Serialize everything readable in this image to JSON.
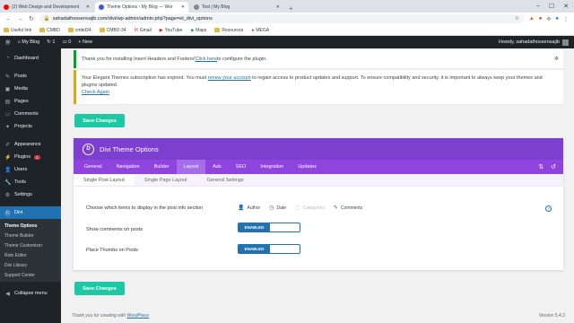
{
  "browser": {
    "tabs": [
      {
        "label": "(2) Web Design and Development",
        "active": false,
        "color": "#ff0000"
      },
      {
        "label": "Theme Options ‹ My Blog — Wor",
        "active": true,
        "color": "#3858e9"
      },
      {
        "label": "Test | My Blog",
        "active": false,
        "color": "#888888"
      }
    ],
    "new_tab": "+",
    "url": "sahadathossensajib.com/divi/wp-admin/admin.php?page=et_divi_options",
    "bookmarks": [
      "Useful link",
      "CMBD",
      "cmbd34",
      "CMBD-34",
      "Gmail",
      "YouTube",
      "Maps",
      "Resources",
      "MEGA"
    ]
  },
  "adminbar": {
    "site": "My Blog",
    "updates_count": "1",
    "comments_count": "0",
    "new_label": "New",
    "greeting": "Howdy, sahadathossensajib"
  },
  "sidebar": {
    "items": [
      {
        "label": "Dashboard",
        "icon": "dashboard-icon"
      },
      {
        "label": "Posts",
        "icon": "pin-icon"
      },
      {
        "label": "Media",
        "icon": "media-icon"
      },
      {
        "label": "Pages",
        "icon": "page-icon"
      },
      {
        "label": "Comments",
        "icon": "comment-icon"
      },
      {
        "label": "Projects",
        "icon": "project-icon"
      },
      {
        "label": "Appearance",
        "icon": "brush-icon"
      },
      {
        "label": "Plugins",
        "icon": "plugin-icon",
        "badge": "1"
      },
      {
        "label": "Users",
        "icon": "user-icon"
      },
      {
        "label": "Tools",
        "icon": "wrench-icon"
      },
      {
        "label": "Settings",
        "icon": "settings-icon"
      },
      {
        "label": "Divi",
        "icon": "divi-icon"
      }
    ],
    "submenu": [
      "Theme Options",
      "Theme Builder",
      "Theme Customizer",
      "Role Editor",
      "Divi Library",
      "Support Center"
    ],
    "collapse": "Collapse menu"
  },
  "notices": {
    "headers_footers": {
      "pre": "Thank you for installing Insert Headers and Footers! ",
      "link": "Click here",
      "post": " to configure the plugin."
    },
    "subscription": {
      "pre": "Your Elegant Themes subscription has expired. You must ",
      "link": "renew your account",
      "post": " to regain access to product updates and support. To ensure compatibility and security, it is important to always keep your themes and plugins updated.",
      "check": "Check Again"
    }
  },
  "save_label": "Save Changes",
  "panel": {
    "title": "Divi Theme Options",
    "logo": "D",
    "tabs": [
      "General",
      "Navigation",
      "Builder",
      "Layout",
      "Ads",
      "SEO",
      "Integration",
      "Updates"
    ],
    "active_tab": "Layout",
    "subtabs": [
      "Single Post Layout",
      "Single Page Layout",
      "General Settings"
    ],
    "options": {
      "post_info_label": "Choose which items to display in the post info section",
      "post_info_items": [
        {
          "label": "Author",
          "enabled": true,
          "icon": "user-icon"
        },
        {
          "label": "Date",
          "enabled": true,
          "icon": "clock-icon"
        },
        {
          "label": "Categories",
          "enabled": false,
          "icon": "folder-icon"
        },
        {
          "label": "Comments",
          "enabled": true,
          "icon": "comment-icon"
        }
      ],
      "show_comments_label": "Show comments on posts",
      "thumbs_label": "Place Thumbs on Posts",
      "enabled_text": "ENABLED"
    }
  },
  "footer": {
    "pre": "Thank you for creating with ",
    "link": "WordPress",
    "version": "Version 5.4.2"
  },
  "colors": {
    "divi_purple": "#7c3fd0",
    "divi_tab_purple": "#8e44dd",
    "save_green": "#1dc9a4",
    "wp_blue": "#2271b1",
    "admin_dark": "#1d2327"
  }
}
